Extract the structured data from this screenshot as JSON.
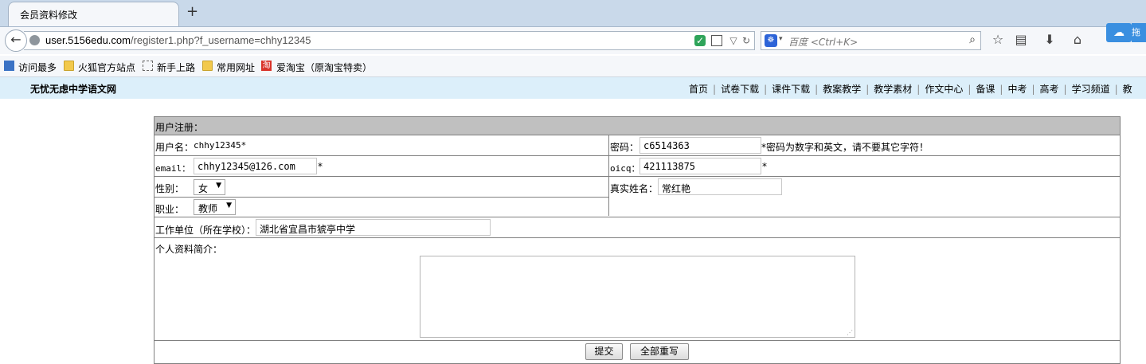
{
  "browser": {
    "tab_title": "会员资料修改",
    "new_tab_symbol": "+",
    "url_host": "user.5156edu.com",
    "url_path": "/register1.php?f_username=chhy12345",
    "search_placeholder": "百度 <Ctrl+K>",
    "cloud_label": "拖"
  },
  "bookmarks": [
    "访问最多",
    "火狐官方站点",
    "新手上路",
    "常用网址",
    "爱淘宝（原淘宝特卖）"
  ],
  "site": {
    "name": "无忧无虑中学语文网",
    "nav": [
      "首页",
      "试卷下载",
      "课件下载",
      "教案教学",
      "教学素材",
      "作文中心",
      "备课",
      "中考",
      "高考",
      "学习频道",
      "教"
    ]
  },
  "form": {
    "header": "用户注册：",
    "username_label": "用户名：",
    "username_value": "chhy12345*",
    "password_label": "密码：",
    "password_value": "c6514363",
    "password_hint": "*密码为数字和英文，请不要其它字符！",
    "email_label": "email：",
    "email_value": "chhy12345@126.com",
    "email_star": "*",
    "oicq_label": "oicq：",
    "oicq_value": "421113875",
    "oicq_star": "*",
    "gender_label": "性别：",
    "gender_value": "女",
    "realname_label": "真实姓名：",
    "realname_value": "常红艳",
    "job_label": "职业：",
    "job_value": "教师",
    "workplace_label": "工作单位（所在学校）：",
    "workplace_value": "湖北省宜昌市猇亭中学",
    "bio_label": "个人资料简介：",
    "submit_label": "提交",
    "reset_label": "全部重写"
  },
  "colors": {
    "site_header_bg": "#dceffa",
    "form_header_bg": "#c0c0c0"
  }
}
